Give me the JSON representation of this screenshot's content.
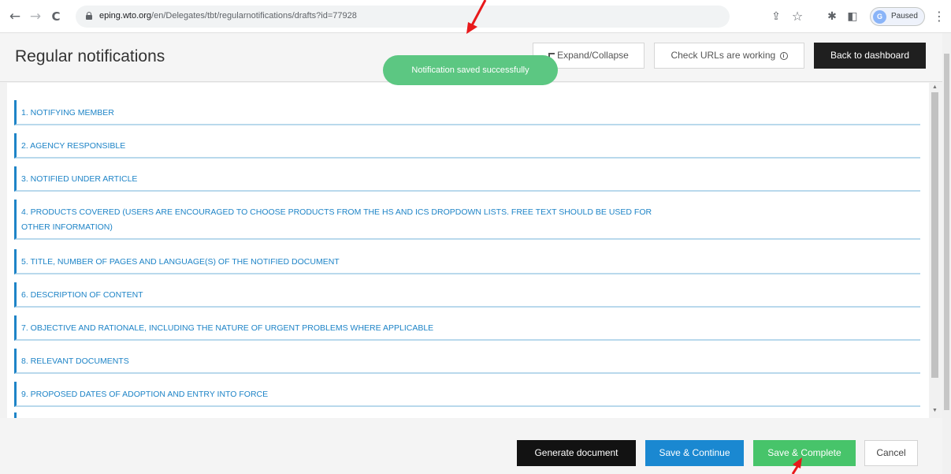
{
  "browser": {
    "back_icon": "←",
    "forward_icon": "→",
    "reload_icon": "C",
    "url_host": "eping.wto.org",
    "url_path": "/en/Delegates/tbt/regularnotifications/drafts?id=77928",
    "share_icon": "⇪",
    "star_icon": "☆",
    "extensions_icon": "✱",
    "sidepanel_icon": "◧",
    "profile_initial": "G",
    "profile_label": "Paused",
    "menu_icon": "⋮"
  },
  "header": {
    "title": "Regular notifications",
    "expand_label": "Expand/Collapse",
    "check_urls_label": "Check URLs are working",
    "info_icon": "i",
    "back_label": "Back to dashboard"
  },
  "toast": {
    "message": "Notification saved successfully",
    "color": "#5cc782"
  },
  "sections": [
    {
      "label": "1. NOTIFYING MEMBER"
    },
    {
      "label": "2. AGENCY RESPONSIBLE"
    },
    {
      "label": "3. NOTIFIED UNDER ARTICLE"
    },
    {
      "label": "4. PRODUCTS COVERED (USERS ARE ENCOURAGED TO CHOOSE PRODUCTS FROM THE HS AND ICS DROPDOWN LISTS. FREE TEXT SHOULD BE USED FOR",
      "label2": "OTHER INFORMATION)"
    },
    {
      "label": "5. TITLE, NUMBER OF PAGES AND LANGUAGE(S) OF THE NOTIFIED DOCUMENT"
    },
    {
      "label": "6. DESCRIPTION OF CONTENT"
    },
    {
      "label": "7. OBJECTIVE AND RATIONALE, INCLUDING THE NATURE OF URGENT PROBLEMS WHERE APPLICABLE"
    },
    {
      "label": "8. RELEVANT DOCUMENTS"
    },
    {
      "label": "9. PROPOSED DATES OF ADOPTION AND ENTRY INTO FORCE"
    }
  ],
  "footer": {
    "generate_label": "Generate document",
    "save_continue_label": "Save & Continue",
    "save_complete_label": "Save & Complete",
    "cancel_label": "Cancel"
  },
  "colors": {
    "section_accent": "#1e84c7",
    "save_continue": "#1a88d1",
    "save_complete": "#47c46a",
    "annotation_arrow": "#e8191b"
  }
}
